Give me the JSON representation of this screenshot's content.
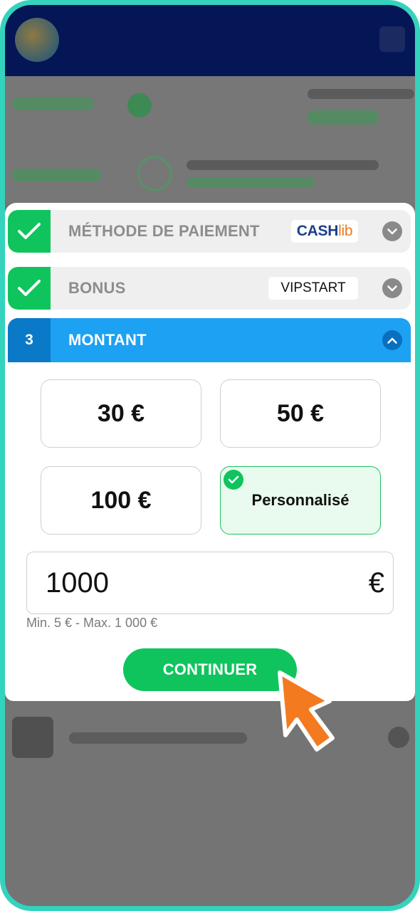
{
  "steps": {
    "payment": {
      "title": "MÉTHODE DE PAIEMENT",
      "method_logo": {
        "main": "CASH",
        "accent": "lib"
      },
      "status_icon": "checkmark-icon",
      "toggle_icon": "chevron-down-icon"
    },
    "bonus": {
      "title": "BONUS",
      "code": "VIPSTART",
      "status_icon": "checkmark-icon",
      "toggle_icon": "chevron-down-icon"
    },
    "amount": {
      "number": "3",
      "title": "MONTANT",
      "toggle_icon": "chevron-up-icon"
    }
  },
  "amount_options": [
    {
      "label": "30 €",
      "selected": false
    },
    {
      "label": "50 €",
      "selected": false
    },
    {
      "label": "100 €",
      "selected": false
    },
    {
      "label": "Personnalisé",
      "selected": true
    }
  ],
  "amount_input": {
    "value": "1000",
    "currency": "€"
  },
  "limits_hint": "Min. 5 € - Max. 1 000 €",
  "continue_label": "CONTINUER",
  "colors": {
    "success": "#0fc45d",
    "active_step": "#1da1f2",
    "active_step_number": "#0a79c8",
    "pointer": "#f47a20",
    "frame": "#34d3bd"
  }
}
